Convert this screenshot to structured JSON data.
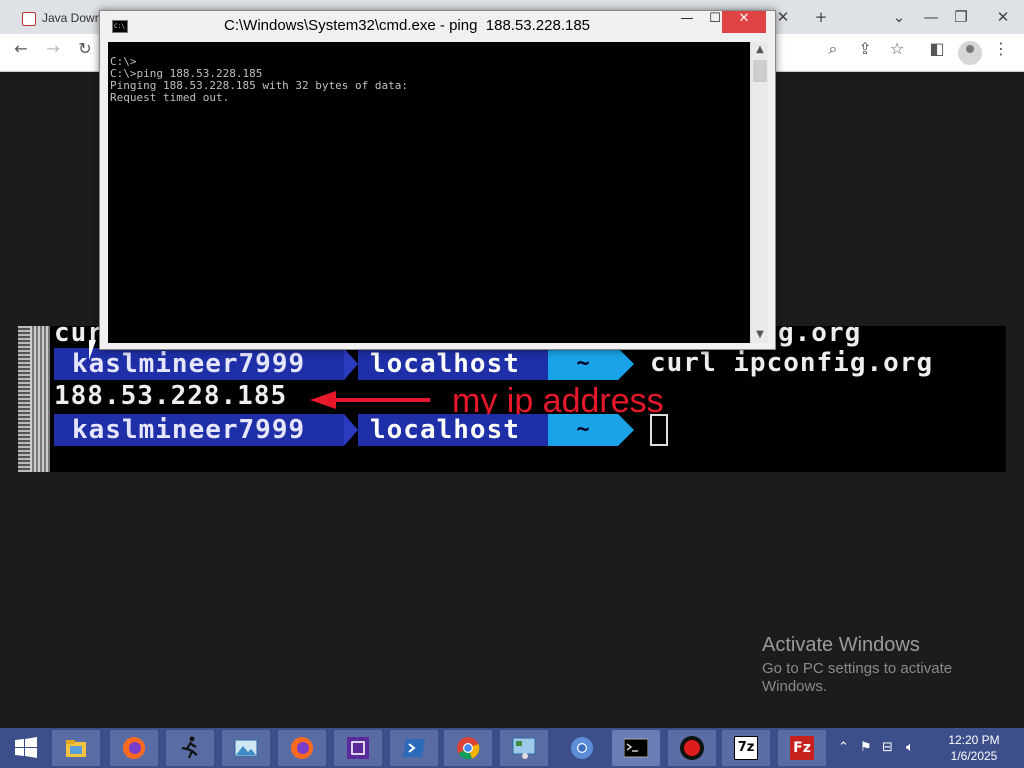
{
  "browser": {
    "tab_label": "Java Down",
    "new_tab_symbol": "+",
    "dropdown_symbol": "⌄",
    "restore_symbol": "❐",
    "minimize_symbol": "—"
  },
  "terminal": {
    "partial_line_left": "cur",
    "partial_line_right": "g.org",
    "prompt_user": "kaslmineer7999",
    "prompt_host": "localhost",
    "prompt_dir": "~",
    "command": "curl ipconfig.org",
    "output_ip": "188.53.228.185",
    "annotation_text": "my ip address",
    "annotation_color": "#e8182a"
  },
  "cmd_window": {
    "title": "C:\\Windows\\System32\\cmd.exe - ping  188.53.228.185",
    "lines": [
      "C:\\>",
      "C:\\>ping 188.53.228.185",
      "",
      "Pinging 188.53.228.185 with 32 bytes of data:",
      "Request timed out."
    ],
    "minimize": "—",
    "maximize": "☐",
    "close": "✕"
  },
  "watermark": {
    "title": "Activate Windows",
    "subtitle": "Go to PC settings to activate Windows."
  },
  "taskbar": {
    "icons": [
      "windows-start-icon",
      "file-explorer-icon",
      "firefox-icon",
      "runner-icon",
      "photos-icon",
      "firefox-icon-2",
      "chip-icon",
      "powershell-icon",
      "chrome-icon",
      "control-panel-icon",
      "chromium-icon",
      "cmd-icon",
      "record-icon",
      "7zip-icon",
      "filezilla-icon"
    ],
    "time": "12:20 PM",
    "date": "1/6/2025",
    "sevenzip_label": "7z",
    "filezilla_label": "Fz"
  }
}
